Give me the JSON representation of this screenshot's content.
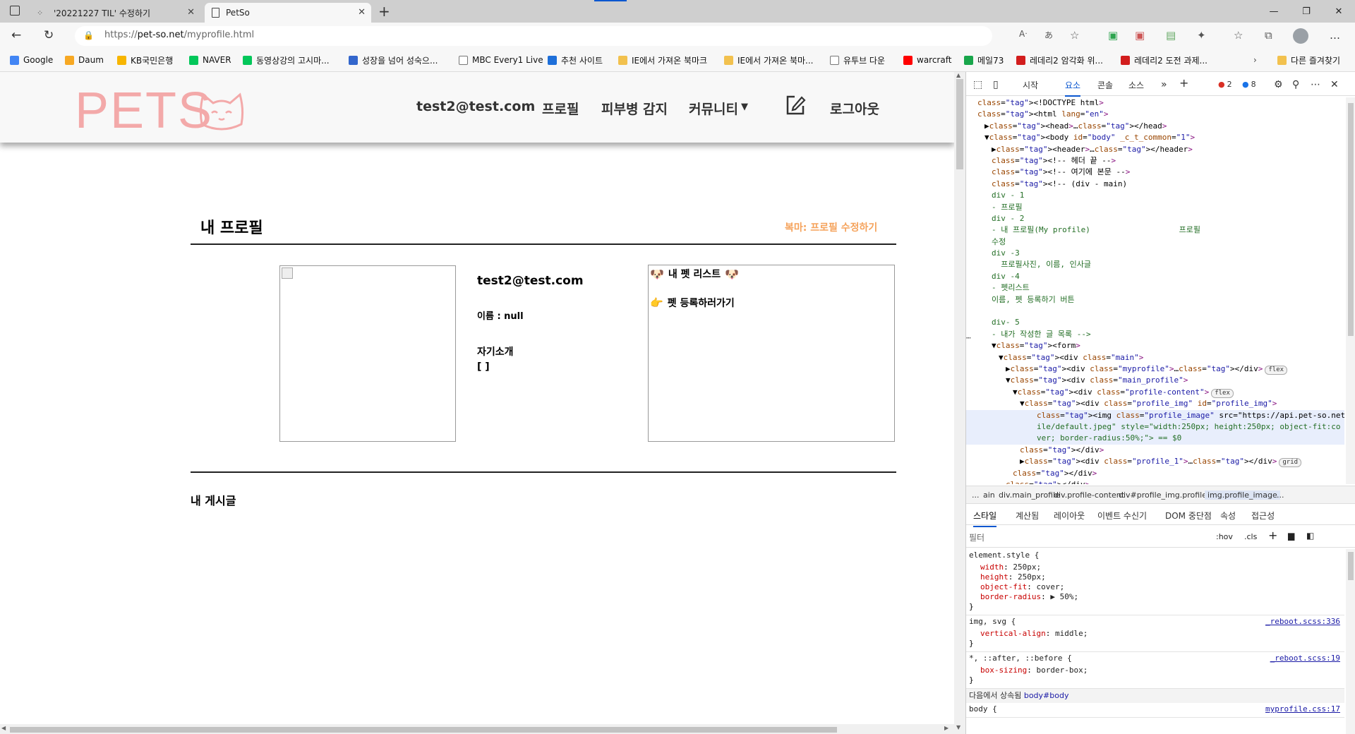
{
  "browser": {
    "tabs": [
      {
        "title": "'20221227 TIL' 수정하기"
      },
      {
        "title": "PetSo"
      }
    ],
    "url_prefix": "https://",
    "url_host": "pet-so.net",
    "url_path": "/myprofile.html",
    "bookmarks": [
      {
        "label": "Google",
        "color": "#4285f4"
      },
      {
        "label": "Daum",
        "color": "#f7a823"
      },
      {
        "label": "KB국민은행",
        "color": "#f7b500"
      },
      {
        "label": "NAVER",
        "color": "#03c75a"
      },
      {
        "label": "동영상강의 고시마...",
        "color": "#03c75a"
      },
      {
        "label": "성장을 넘어 성숙으...",
        "color": "#3366cc"
      },
      {
        "label": "MBC Every1 Live",
        "color": "#777777"
      },
      {
        "label": "추천 사이트",
        "color": "#1e6fd9"
      },
      {
        "label": "IE에서 가져온 북마크",
        "color": "#f2c14e"
      },
      {
        "label": "IE에서 가져온 북마...",
        "color": "#f2c14e"
      },
      {
        "label": "유투브 다운",
        "color": "#777777"
      },
      {
        "label": "warcraft",
        "color": "#ff0000"
      },
      {
        "label": "메일73",
        "color": "#19a64b"
      },
      {
        "label": "레데리2 암각화 위...",
        "color": "#d21d1d"
      },
      {
        "label": "레데리2 도전 과제...",
        "color": "#d21d1d"
      }
    ],
    "other_favorites": "다른 즐겨찾기"
  },
  "site": {
    "logo": "PETS",
    "nav": {
      "email": "test2@test.com",
      "profile": "프로필",
      "skin": "피부병 감지",
      "community": "커뮤니티",
      "logout": "로그아웃"
    },
    "profile": {
      "title": "내 프로필",
      "edit": "복마: 프로필 수정하기",
      "email": "test2@test.com",
      "name": "이름 : null",
      "intro_label": "자기소개",
      "intro_value": "[ ]",
      "pet_list": "내 펫 리스트",
      "pet_register": "펫 등록하러가기",
      "my_posts": "내 게시글"
    }
  },
  "devtools": {
    "tabs": [
      "시작",
      "요소",
      "콘솔",
      "소스"
    ],
    "errors": "2",
    "messages": "8",
    "dom": [
      {
        "d": 0,
        "html": "<!DOCTYPE html>"
      },
      {
        "d": 0,
        "html": "<html lang=\"en\">"
      },
      {
        "d": 1,
        "html": "▶<head>…</head>"
      },
      {
        "d": 1,
        "html": "▼<body id=\"body\" _c_t_common=\"1\">"
      },
      {
        "d": 2,
        "html": "▶<header>…</header>"
      },
      {
        "d": 2,
        "html": "<!-- 헤더 끝 -->"
      },
      {
        "d": 2,
        "html": "<!-- 여기에 본문 -->"
      },
      {
        "d": 2,
        "html": "<!-- (div - main)"
      },
      {
        "d": 2,
        "html": "div - 1"
      },
      {
        "d": 2,
        "html": "- 프로필"
      },
      {
        "d": 2,
        "html": "div - 2"
      },
      {
        "d": 2,
        "html": "- 내 프로필(My profile)                   프로필"
      },
      {
        "d": 2,
        "html": "수정"
      },
      {
        "d": 2,
        "html": "div -3"
      },
      {
        "d": 2,
        "html": "  프로필사진, 이름, 인사글"
      },
      {
        "d": 2,
        "html": "div -4"
      },
      {
        "d": 2,
        "html": "- 펫리스트"
      },
      {
        "d": 2,
        "html": "이름, 펫 등록하기 버튼"
      },
      {
        "d": 2,
        "html": ""
      },
      {
        "d": 2,
        "html": "div- 5"
      },
      {
        "d": 2,
        "html": "- 내가 작성한 글 목록 -->"
      },
      {
        "d": 2,
        "html": "▼<form>"
      },
      {
        "d": 3,
        "html": "▼<div class=\"main\">"
      },
      {
        "d": 4,
        "html": "▶<div class=\"myprofile\">…</div>",
        "pill": "flex"
      },
      {
        "d": 4,
        "html": "▼<div class=\"main_profile\">"
      },
      {
        "d": 5,
        "html": "▼<div class=\"profile-content\">",
        "pill": "flex"
      },
      {
        "d": 6,
        "html": "▼<div class=\"profile_img\" id=\"profile_img\">"
      },
      {
        "d": 7,
        "html": "<img class=\"profile_image\" src=\"https://api.pet-so.net/media/prof"
      },
      {
        "d": 7,
        "html": "ile/default.jpeg\" style=\"width:250px; height:250px; object-fit:co"
      },
      {
        "d": 7,
        "html": "ver; border-radius:50%;\"> == $0"
      },
      {
        "d": 6,
        "html": "</div>"
      },
      {
        "d": 6,
        "html": "▶<div class=\"profile_1\">…</div>",
        "pill": "grid"
      },
      {
        "d": 5,
        "html": "</div>"
      },
      {
        "d": 4,
        "html": "</div>"
      }
    ],
    "breadcrumbs": [
      "...",
      "ain",
      "div.main_profile",
      "div.profile-content",
      "div#profile_img.profile_img",
      "img.profile_image",
      "..."
    ],
    "style_tabs": [
      "스타일",
      "계산됨",
      "레이아웃",
      "이벤트 수신기",
      "DOM 중단점",
      "속성",
      "접근성"
    ],
    "filter_placeholder": "필터",
    "hov": ":hov",
    "cls": ".cls",
    "rules": [
      {
        "selector": "element.style {",
        "src": "",
        "props": [
          [
            "width",
            "250px;"
          ],
          [
            "height",
            "250px;"
          ],
          [
            "object-fit",
            "cover;"
          ],
          [
            "border-radius",
            "▶ 50%;"
          ]
        ]
      },
      {
        "selector": "img, svg {",
        "src": "_reboot.scss:336",
        "props": [
          [
            "vertical-align",
            "middle;"
          ]
        ]
      },
      {
        "selector": "*, ::after, ::before {",
        "src": "_reboot.scss:19",
        "props": [
          [
            "box-sizing",
            "border-box;"
          ]
        ]
      }
    ],
    "inherited_label": "다음에서 상속됨",
    "inherited_from": "body#body",
    "body_rule": "body {",
    "body_src": "myprofile.css:17"
  }
}
